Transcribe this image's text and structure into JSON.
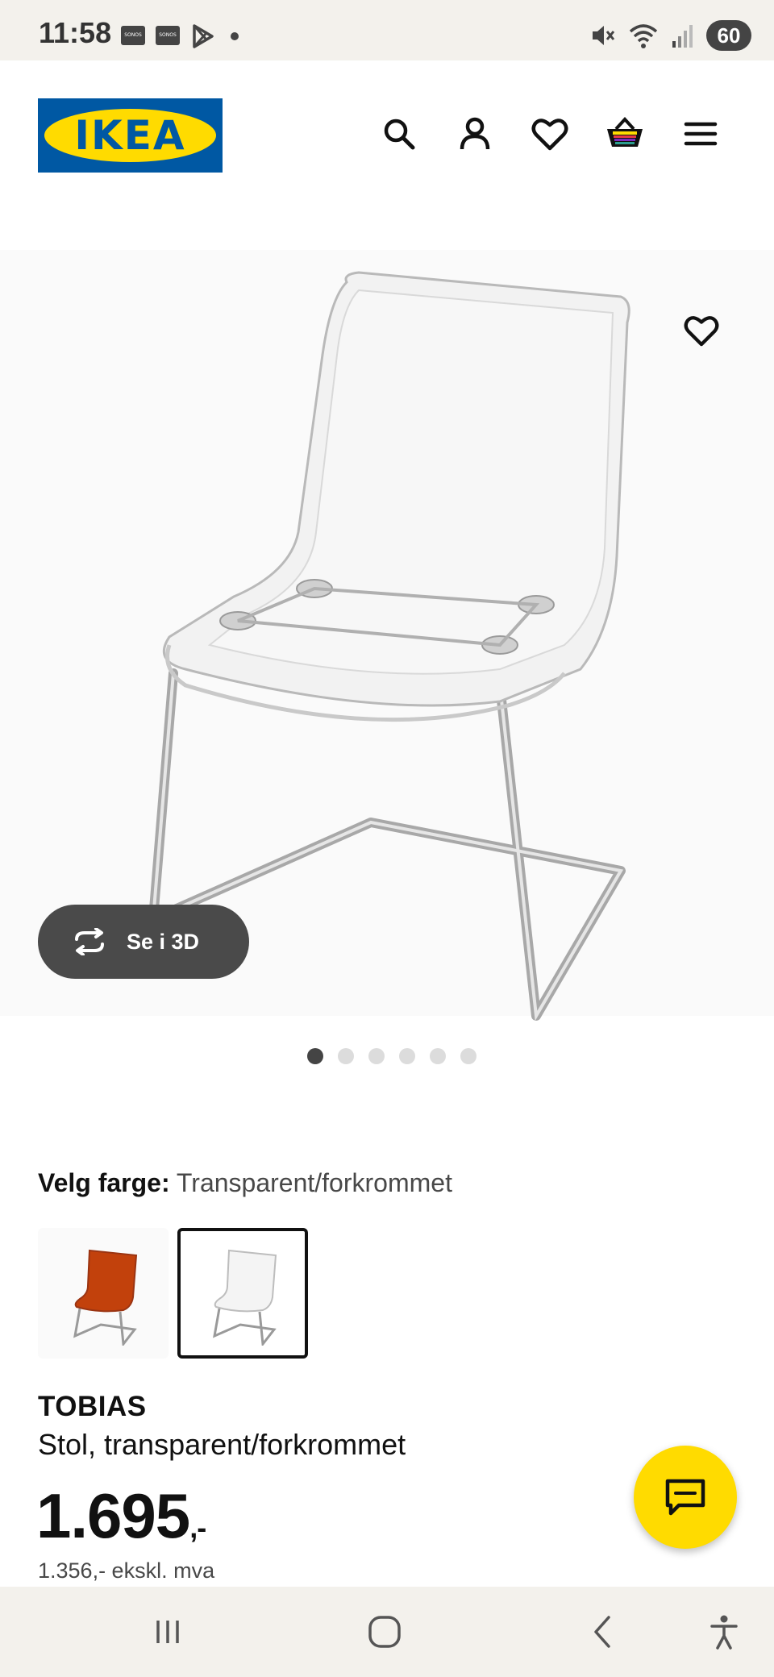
{
  "status_bar": {
    "time": "11:58",
    "notification_icons": [
      "sonos-icon",
      "sonos-icon",
      "play-store-icon"
    ],
    "battery": "60"
  },
  "header": {
    "logo_text": "IKEA",
    "icons": [
      "search-icon",
      "account-icon",
      "heart-icon",
      "basket-icon",
      "menu-icon"
    ]
  },
  "gallery": {
    "btn_3d_label": "Se i 3D",
    "dots_total": 6,
    "active_dot": 1
  },
  "color": {
    "label": "Velg farge:",
    "value": "Transparent/forkrommet",
    "swatches": [
      "orange",
      "transparent"
    ],
    "selected_index": 1
  },
  "product": {
    "name": "TOBIAS",
    "description": "Stol, transparent/forkrommet",
    "price_main": "1.695",
    "price_suffix": ",-",
    "price_ex_vat": "1.356,- ekskl. mva"
  },
  "colors": {
    "ikea_blue": "#0058a3",
    "ikea_yellow": "#ffdb00",
    "chip_dark": "#4a4a4a"
  }
}
